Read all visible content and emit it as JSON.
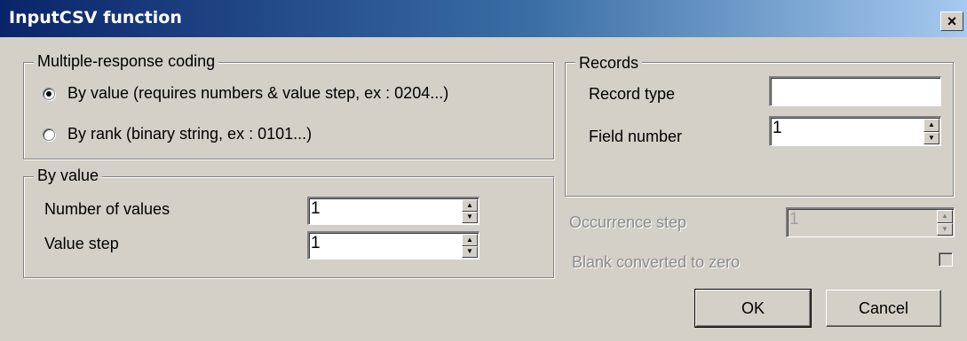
{
  "window": {
    "title": "InputCSV function",
    "close_glyph": "×"
  },
  "coding": {
    "legend": "Multiple-response coding",
    "options": [
      {
        "label": "By value (requires numbers & value step, ex : 0204...)",
        "checked": true
      },
      {
        "label": "By rank (binary string, ex : 0101...)",
        "checked": false
      }
    ]
  },
  "by_value": {
    "legend": "By value",
    "number_of_values_label": "Number of values",
    "number_of_values": "1",
    "value_step_label": "Value step",
    "value_step": "1"
  },
  "records": {
    "legend": "Records",
    "record_type_label": "Record type",
    "record_type": "",
    "field_number_label": "Field number",
    "field_number": "1"
  },
  "options": {
    "occurrence_step_label": "Occurrence step",
    "occurrence_step": "1",
    "blank_label": "Blank converted to zero",
    "blank_checked": false
  },
  "buttons": {
    "ok": "OK",
    "cancel": "Cancel"
  },
  "icons": {
    "spin_up": "▲",
    "spin_down": "▼"
  }
}
